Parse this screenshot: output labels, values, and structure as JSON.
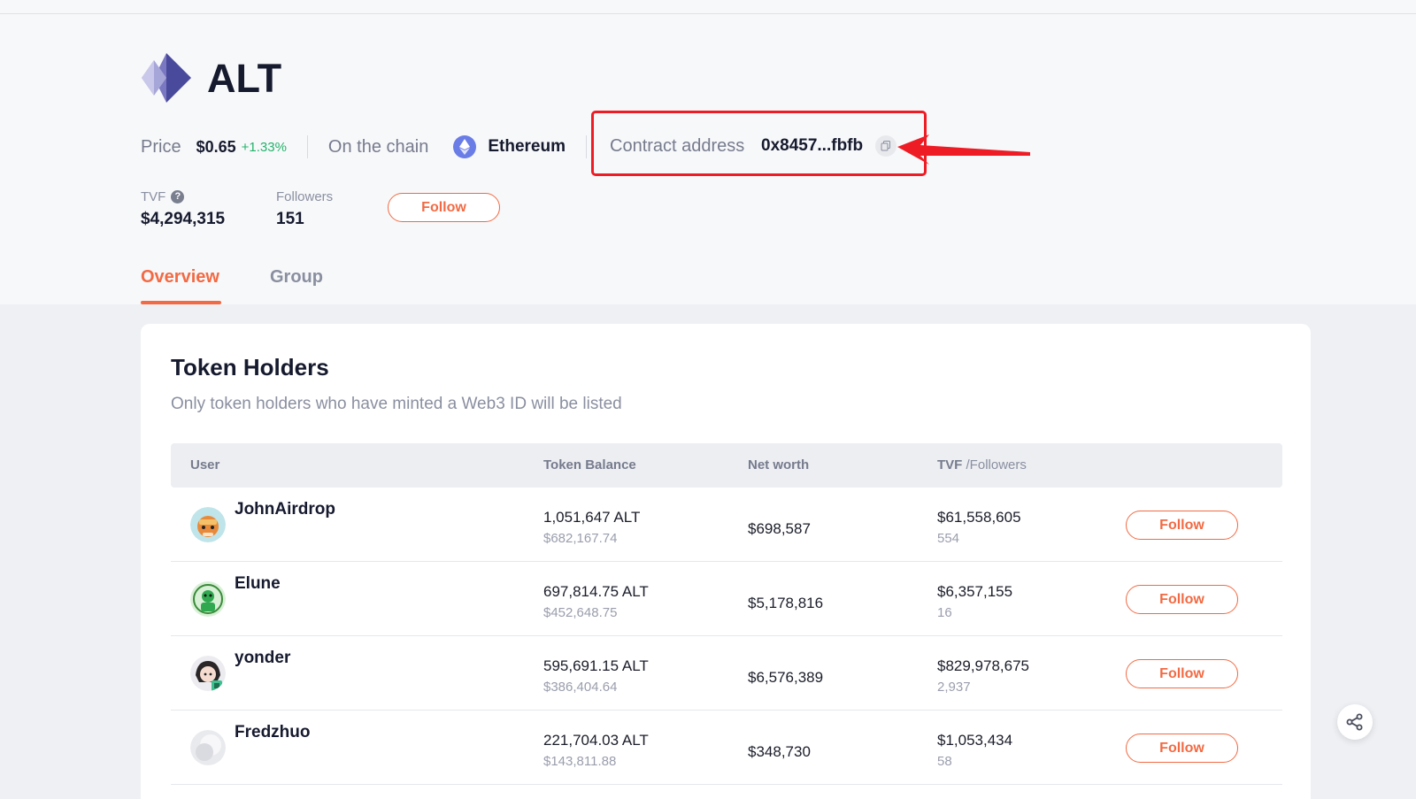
{
  "token": {
    "name": "ALT",
    "price_label": "Price",
    "price": "$0.65",
    "price_change": "+1.33%",
    "chain_label": "On the chain",
    "chain": "Ethereum",
    "contract_label": "Contract address",
    "contract": "0x8457...fbfb",
    "tvf_label": "TVF",
    "tvf": "$4,294,315",
    "followers_label": "Followers",
    "followers": "151",
    "follow_label": "Follow"
  },
  "tabs": [
    {
      "label": "Overview",
      "active": true
    },
    {
      "label": "Group",
      "active": false
    }
  ],
  "holders": {
    "title": "Token Holders",
    "subtitle": "Only token holders who have minted a Web3 ID will be listed",
    "columns": {
      "user": "User",
      "balance": "Token Balance",
      "networth": "Net worth",
      "tvf": "TVF",
      "followers": "/Followers"
    },
    "rows": [
      {
        "user": "JohnAirdrop",
        "balance": "1,051,647 ALT",
        "balance_usd": "$682,167.74",
        "networth": "$698,587",
        "tvf": "$61,558,605",
        "followers": "554",
        "follow": "Follow"
      },
      {
        "user": "Elune",
        "balance": "697,814.75 ALT",
        "balance_usd": "$452,648.75",
        "networth": "$5,178,816",
        "tvf": "$6,357,155",
        "followers": "16",
        "follow": "Follow"
      },
      {
        "user": "yonder",
        "balance": "595,691.15 ALT",
        "balance_usd": "$386,404.64",
        "networth": "$6,576,389",
        "tvf": "$829,978,675",
        "followers": "2,937",
        "follow": "Follow"
      },
      {
        "user": "Fredzhuo",
        "balance": "221,704.03 ALT",
        "balance_usd": "$143,811.88",
        "networth": "$348,730",
        "tvf": "$1,053,434",
        "followers": "58",
        "follow": "Follow"
      }
    ]
  },
  "colors": {
    "accent": "#f26a43",
    "positive": "#22b36b",
    "highlight": "#ee1c25",
    "chain": "#6a7ce6"
  },
  "icons": [
    "token-logo",
    "ethereum-icon",
    "copy-icon",
    "help-icon",
    "share-icon"
  ]
}
